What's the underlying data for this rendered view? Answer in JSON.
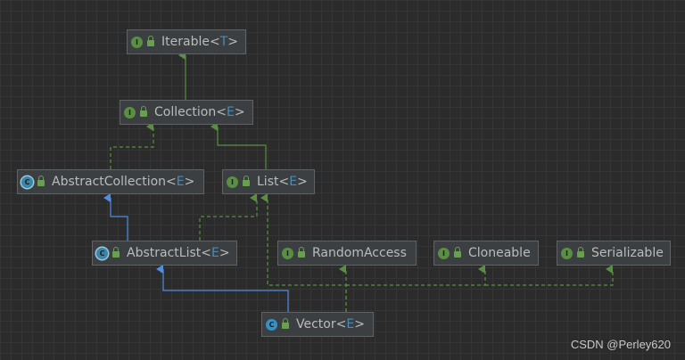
{
  "colors": {
    "extends_edge": "#5a8f43",
    "implements_edge": "#5a8f43",
    "class_extends_edge": "#4f8ee0",
    "node_bg": "#3c3f41"
  },
  "nodes": {
    "iterable": {
      "name": "Iterable",
      "lt": "<",
      "tp": "T",
      "gt": ">",
      "kind": "interface",
      "kind_glyph": "I"
    },
    "collection": {
      "name": "Collection",
      "lt": "<",
      "tp": "E",
      "gt": ">",
      "kind": "interface",
      "kind_glyph": "I"
    },
    "abstract_collection": {
      "name": "AbstractCollection",
      "lt": "<",
      "tp": "E",
      "gt": ">",
      "kind": "abstract",
      "kind_glyph": "C"
    },
    "list": {
      "name": "List",
      "lt": "<",
      "tp": "E",
      "gt": ">",
      "kind": "interface",
      "kind_glyph": "I"
    },
    "abstract_list": {
      "name": "AbstractList",
      "lt": "<",
      "tp": "E",
      "gt": ">",
      "kind": "abstract",
      "kind_glyph": "C"
    },
    "random_access": {
      "name": "RandomAccess",
      "lt": "",
      "tp": "",
      "gt": "",
      "kind": "interface",
      "kind_glyph": "I"
    },
    "cloneable": {
      "name": "Cloneable",
      "lt": "",
      "tp": "",
      "gt": "",
      "kind": "interface",
      "kind_glyph": "I"
    },
    "serializable": {
      "name": "Serializable",
      "lt": "",
      "tp": "",
      "gt": "",
      "kind": "interface",
      "kind_glyph": "I"
    },
    "vector": {
      "name": "Vector",
      "lt": "<",
      "tp": "E",
      "gt": ">",
      "kind": "class",
      "kind_glyph": "C"
    }
  },
  "edges": [
    {
      "from": "collection",
      "to": "iterable",
      "type": "extends"
    },
    {
      "from": "abstract_collection",
      "to": "collection",
      "type": "implements"
    },
    {
      "from": "list",
      "to": "collection",
      "type": "extends"
    },
    {
      "from": "abstract_list",
      "to": "abstract_collection",
      "type": "class_extends"
    },
    {
      "from": "abstract_list",
      "to": "list",
      "type": "implements"
    },
    {
      "from": "vector",
      "to": "abstract_list",
      "type": "class_extends"
    },
    {
      "from": "vector",
      "to": "list",
      "type": "implements"
    },
    {
      "from": "vector",
      "to": "random_access",
      "type": "implements"
    },
    {
      "from": "vector",
      "to": "cloneable",
      "type": "implements"
    },
    {
      "from": "vector",
      "to": "serializable",
      "type": "implements"
    }
  ],
  "watermark": "CSDN @Perley620"
}
